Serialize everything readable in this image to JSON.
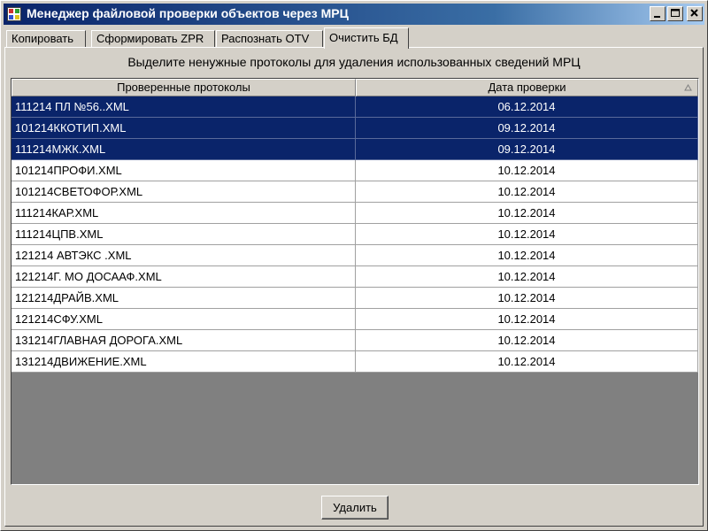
{
  "window": {
    "title": "Менеджер файловой проверки объектов через МРЦ",
    "icon": "app-window-icon",
    "controls": [
      "minimize-icon",
      "maximize-icon",
      "close-icon"
    ]
  },
  "tabs": [
    {
      "label": "Копировать",
      "active": false
    },
    {
      "label": "Сформировать ZPR",
      "active": false
    },
    {
      "label": "Распознать OTV",
      "active": false
    },
    {
      "label": "Очистить БД",
      "active": true
    }
  ],
  "main": {
    "instruction": "Выделите ненужные протоколы для удаления использованных сведений МРЦ",
    "grid": {
      "columns": [
        "Проверенные протоколы",
        "Дата проверки"
      ],
      "sort_icon": "sort-ascending-icon",
      "rows": [
        {
          "name": "111214 ПЛ №56..XML",
          "date": "06.12.2014",
          "selected": true
        },
        {
          "name": "101214ККОТИП.XML",
          "date": "09.12.2014",
          "selected": true
        },
        {
          "name": "111214МЖК.XML",
          "date": "09.12.2014",
          "selected": true
        },
        {
          "name": "101214ПРОФИ.XML",
          "date": "10.12.2014",
          "selected": false
        },
        {
          "name": "101214СВЕТОФОР.XML",
          "date": "10.12.2014",
          "selected": false
        },
        {
          "name": "111214КАР.XML",
          "date": "10.12.2014",
          "selected": false
        },
        {
          "name": "111214ЦПВ.XML",
          "date": "10.12.2014",
          "selected": false
        },
        {
          "name": "121214 АВТЭКС .XML",
          "date": "10.12.2014",
          "selected": false
        },
        {
          "name": "121214Г. МО ДОСААФ.XML",
          "date": "10.12.2014",
          "selected": false
        },
        {
          "name": "121214ДРАЙВ.XML",
          "date": "10.12.2014",
          "selected": false
        },
        {
          "name": "121214СФУ.XML",
          "date": "10.12.2014",
          "selected": false
        },
        {
          "name": "131214ГЛАВНАЯ ДОРОГА.XML",
          "date": "10.12.2014",
          "selected": false
        },
        {
          "name": "131214ДВИЖЕНИЕ.XML",
          "date": "10.12.2014",
          "selected": false
        }
      ]
    },
    "delete_label": "Удалить"
  },
  "colors": {
    "face": "#d4d0c8",
    "titlebar": "#0a246a",
    "selection": "#0a246a",
    "grid_background": "#808080"
  }
}
